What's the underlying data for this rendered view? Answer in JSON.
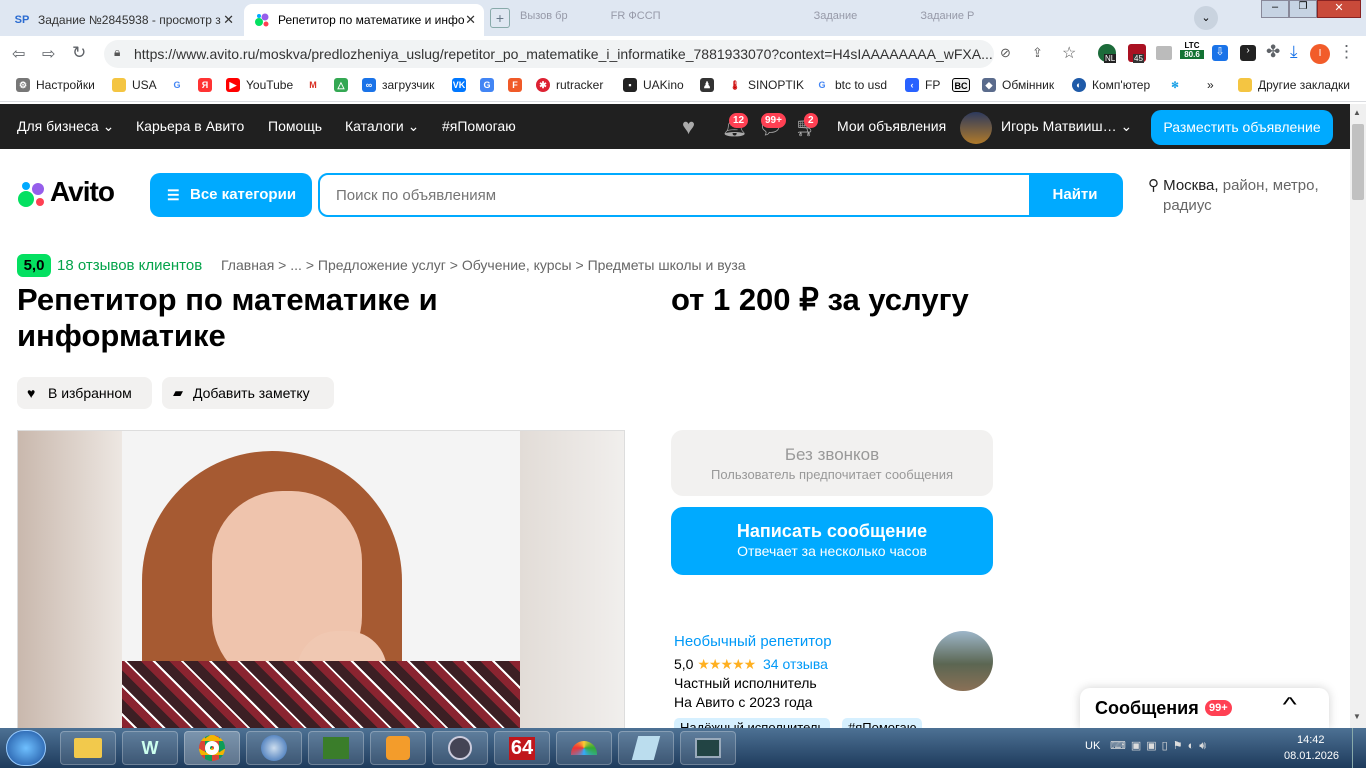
{
  "browser": {
    "tabs": [
      {
        "label": "Задание №2845938 - просмотр з",
        "favicon": "SP"
      },
      {
        "label": "Репетитор по математике и инфо",
        "favicon": "avito-icon"
      },
      {
        "label": "Вызов бр",
        "favicon": ""
      },
      {
        "label": "FR ФССП",
        "favicon": ""
      },
      {
        "label": "Задание",
        "favicon": ""
      },
      {
        "label": "Задание Р",
        "favicon": ""
      }
    ],
    "url": "https://www.avito.ru/moskva/predlozheniya_uslug/repetitor_po_matematike_i_informatike_7881933070?context=H4sIAAAAAAAA_wFXA...",
    "ext_badges": {
      "nl": "NL",
      "n45": "45",
      "ltc": "LTC",
      "ltc_val": "80.6"
    },
    "bookmarks": [
      "Настройки",
      "USA",
      "",
      "",
      "YouTube",
      "",
      "",
      "загрузчик",
      "",
      "",
      "",
      "rutracker",
      "UAKino",
      "",
      "SINOPTIK",
      "btc to usd",
      "FP",
      "BC",
      "Обмінник",
      "Комп'ютер",
      "",
      "»",
      "Другие закладки"
    ]
  },
  "avito": {
    "nav": {
      "business": "Для бизнеса",
      "career": "Карьера в Авито",
      "help": "Помощь",
      "catalogs": "Каталоги",
      "help_tag": "#яПомогаю",
      "notif_badge": "12",
      "msg_badge": "99+",
      "cart_badge": "2",
      "my_ads": "Мои объявления",
      "user": "Игорь Матвииш…",
      "post_ad": "Разместить объявление"
    },
    "logo": "Avito",
    "categories_btn": "Все категории",
    "search_placeholder": "Поиск по объявлениям",
    "search_btn": "Найти",
    "location_city": "Москва,",
    "location_rest": "район, метро,",
    "location_rest2": "радиус"
  },
  "listing": {
    "rating": "5,0",
    "reviews_link": "18 отзывов клиентов",
    "breadcrumbs": [
      "Главная",
      "...",
      "Предложение услуг",
      "Обучение, курсы",
      "Предметы школы и вуза"
    ],
    "title": "Репетитор по математике и информатике",
    "price": "от 1 200 ₽ за услугу",
    "fav_btn": "В избранном",
    "note_btn": "Добавить заметку",
    "no_calls": "Без звонков",
    "no_calls_sub": "Пользователь предпочитает сообщения",
    "write_btn": "Написать сообщение",
    "write_sub": "Отвечает за несколько часов",
    "seller": {
      "name": "Необычный репетитор",
      "rating": "5,0",
      "stars": 5,
      "reviews": "34 отзыва",
      "type": "Частный исполнитель",
      "since": "На Авито с 2023 года",
      "tag1": "Надёжный исполнитель",
      "tag2": "#яПомогаю"
    },
    "messages_panel": "Сообщения",
    "messages_badge": "99+"
  },
  "taskbar": {
    "lang": "UK",
    "time": "14:42",
    "date": "08.01.2026",
    "app64": "64"
  }
}
